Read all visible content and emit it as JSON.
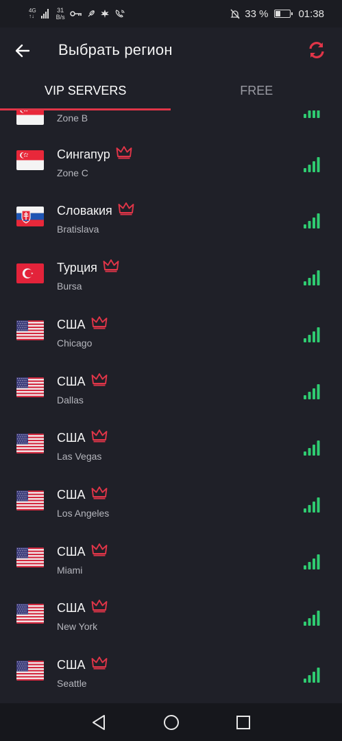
{
  "status_bar": {
    "network_type_top": "4G",
    "network_type_bottom": "↑↓",
    "speed_value": "31",
    "speed_unit": "B/s",
    "battery": "33 %",
    "battery_level": 0.33,
    "time": "01:38"
  },
  "header": {
    "title": "Выбрать регион"
  },
  "tabs": [
    {
      "label": "VIP SERVERS",
      "active": true
    },
    {
      "label": "FREE",
      "active": false
    }
  ],
  "colors": {
    "accent": "#e03548",
    "signal": "#2fcc71",
    "background": "#1f2028"
  },
  "servers": [
    {
      "country": "",
      "city": "Zone B",
      "flag": "singapore",
      "vip": false,
      "signal_level": 4
    },
    {
      "country": "Сингапур",
      "city": "Zone C",
      "flag": "singapore",
      "vip": true,
      "signal_level": 4
    },
    {
      "country": "Словакия",
      "city": "Bratislava",
      "flag": "slovakia",
      "vip": true,
      "signal_level": 4
    },
    {
      "country": "Турция",
      "city": "Bursa",
      "flag": "turkey",
      "vip": true,
      "signal_level": 4
    },
    {
      "country": "США",
      "city": "Chicago",
      "flag": "usa",
      "vip": true,
      "signal_level": 4
    },
    {
      "country": "США",
      "city": "Dallas",
      "flag": "usa",
      "vip": true,
      "signal_level": 4
    },
    {
      "country": "США",
      "city": "Las Vegas",
      "flag": "usa",
      "vip": true,
      "signal_level": 4
    },
    {
      "country": "США",
      "city": "Los Angeles",
      "flag": "usa",
      "vip": true,
      "signal_level": 4
    },
    {
      "country": "США",
      "city": "Miami",
      "flag": "usa",
      "vip": true,
      "signal_level": 4
    },
    {
      "country": "США",
      "city": "New York",
      "flag": "usa",
      "vip": true,
      "signal_level": 4
    },
    {
      "country": "США",
      "city": "Seattle",
      "flag": "usa",
      "vip": true,
      "signal_level": 4
    }
  ]
}
